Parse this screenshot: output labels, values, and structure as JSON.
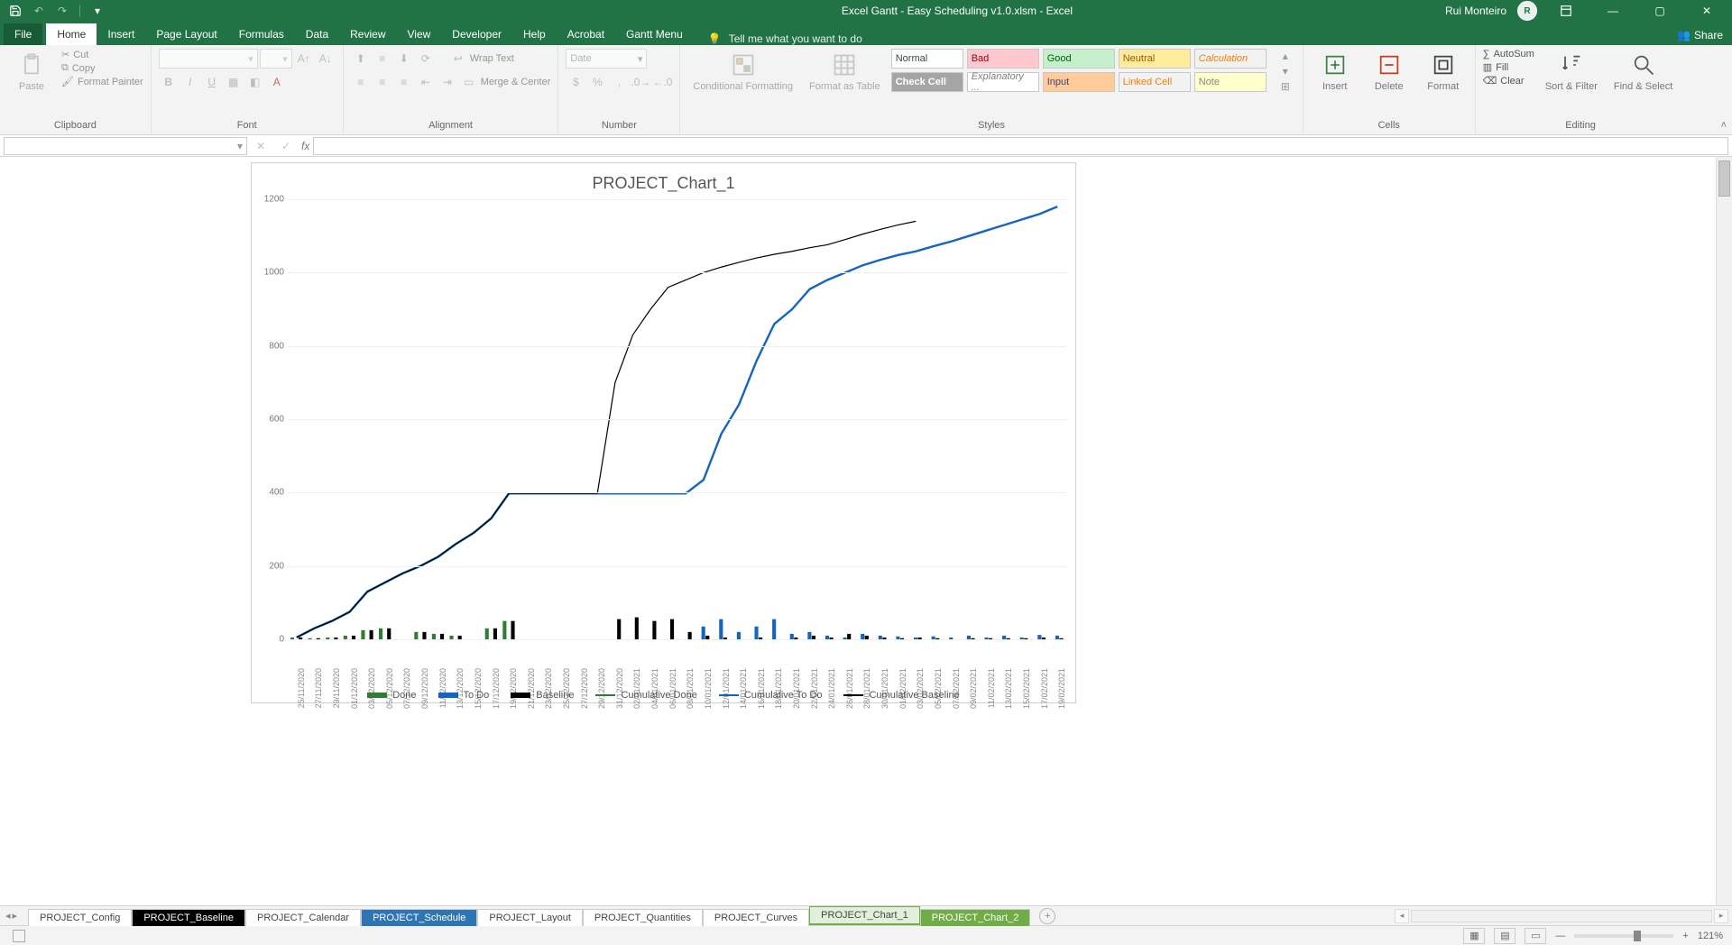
{
  "app": {
    "title": "Excel Gantt - Easy Scheduling v1.0.xlsm  -  Excel",
    "user": "Rui Monteiro"
  },
  "qat": {
    "save": "💾",
    "undo": "↶",
    "redo": "↷"
  },
  "tabs": [
    "File",
    "Home",
    "Insert",
    "Page Layout",
    "Formulas",
    "Data",
    "Review",
    "View",
    "Developer",
    "Help",
    "Acrobat",
    "Gantt Menu"
  ],
  "tell_me": "Tell me what you want to do",
  "share": "Share",
  "ribbon": {
    "clipboard": {
      "label": "Clipboard",
      "paste": "Paste",
      "cut": "Cut",
      "copy": "Copy",
      "painter": "Format Painter"
    },
    "font": {
      "label": "Font",
      "size": ""
    },
    "alignment": {
      "label": "Alignment",
      "wrap": "Wrap Text",
      "merge": "Merge & Center"
    },
    "number": {
      "label": "Number",
      "format": "Date"
    },
    "styles": {
      "label": "Styles",
      "cond": "Conditional Formatting",
      "table": "Format as Table",
      "cells": [
        "Normal",
        "Bad",
        "Good",
        "Neutral",
        "Calculation",
        "Check Cell",
        "Explanatory ...",
        "Input",
        "Linked Cell",
        "Note"
      ]
    },
    "cells": {
      "label": "Cells",
      "insert": "Insert",
      "delete": "Delete",
      "format": "Format"
    },
    "editing": {
      "label": "Editing",
      "autosum": "AutoSum",
      "fill": "Fill",
      "clear": "Clear",
      "sort": "Sort & Filter",
      "find": "Find & Select"
    }
  },
  "sheets": [
    "PROJECT_Config",
    "PROJECT_Baseline",
    "PROJECT_Calendar",
    "PROJECT_Schedule",
    "PROJECT_Layout",
    "PROJECT_Quantities",
    "PROJECT_Curves",
    "PROJECT_Chart_1",
    "PROJECT_Chart_2"
  ],
  "status": {
    "zoom": "121%"
  },
  "chart_data": {
    "type": "combo",
    "title": "PROJECT_Chart_1",
    "ylabel": "",
    "ylim": [
      0,
      1200
    ],
    "yticks": [
      0,
      200,
      400,
      600,
      800,
      1000,
      1200
    ],
    "categories": [
      "25/11/2020",
      "27/11/2020",
      "29/11/2020",
      "01/12/2020",
      "03/12/2020",
      "05/12/2020",
      "07/12/2020",
      "09/12/2020",
      "11/12/2020",
      "13/12/2020",
      "15/12/2020",
      "17/12/2020",
      "19/12/2020",
      "21/12/2020",
      "23/12/2020",
      "25/12/2020",
      "27/12/2020",
      "29/12/2020",
      "31/12/2020",
      "02/01/2021",
      "04/01/2021",
      "06/01/2021",
      "08/01/2021",
      "10/01/2021",
      "12/01/2021",
      "14/01/2021",
      "16/01/2021",
      "18/01/2021",
      "20/01/2021",
      "22/01/2021",
      "24/01/2021",
      "26/01/2021",
      "28/01/2021",
      "30/01/2021",
      "01/02/2021",
      "03/02/2021",
      "05/02/2021",
      "07/02/2021",
      "09/02/2021",
      "11/02/2021",
      "13/02/2021",
      "15/02/2021",
      "17/02/2021",
      "19/02/2021"
    ],
    "series": [
      {
        "name": "Done",
        "type": "bar",
        "color": "#2e7d32",
        "values": [
          5,
          3,
          5,
          10,
          25,
          30,
          0,
          20,
          15,
          10,
          0,
          30,
          50,
          0,
          0,
          0,
          0,
          0,
          0,
          0,
          0,
          0,
          0,
          0,
          0,
          0,
          0,
          0,
          0,
          0,
          0,
          0,
          0,
          0,
          0,
          0,
          0,
          0,
          0,
          0,
          0,
          0,
          0,
          0
        ]
      },
      {
        "name": "To Do",
        "type": "bar",
        "color": "#1565c0",
        "values": [
          0,
          0,
          0,
          0,
          0,
          0,
          0,
          0,
          0,
          0,
          0,
          0,
          0,
          0,
          0,
          0,
          0,
          0,
          0,
          0,
          0,
          0,
          0,
          35,
          55,
          20,
          35,
          55,
          15,
          20,
          10,
          5,
          15,
          10,
          8,
          5,
          8,
          5,
          10,
          5,
          10,
          5,
          12,
          10
        ]
      },
      {
        "name": "Baseline",
        "type": "bar",
        "color": "#000000",
        "values": [
          5,
          3,
          5,
          10,
          25,
          30,
          0,
          20,
          15,
          10,
          0,
          30,
          50,
          0,
          0,
          0,
          0,
          0,
          55,
          60,
          50,
          55,
          20,
          10,
          5,
          0,
          5,
          0,
          5,
          10,
          5,
          15,
          10,
          5,
          3,
          5,
          3,
          0,
          3,
          3,
          3,
          3,
          5,
          3
        ]
      },
      {
        "name": "Cumulative Done",
        "type": "line",
        "color": "#2e7d32",
        "values": [
          5,
          30,
          50,
          75,
          130,
          155,
          180,
          200,
          225,
          260,
          290,
          330,
          398,
          398,
          398,
          398,
          398,
          398,
          398,
          398,
          398,
          398,
          398,
          398,
          398,
          398,
          398,
          398,
          398,
          398,
          398,
          398,
          398,
          398,
          398,
          398,
          398,
          398,
          398,
          398,
          398,
          398,
          398,
          398
        ],
        "cutoff_index": 22
      },
      {
        "name": "Cumulative To Do",
        "type": "line",
        "color": "#1565c0",
        "values": [
          5,
          30,
          50,
          75,
          130,
          155,
          180,
          200,
          225,
          260,
          290,
          330,
          398,
          398,
          398,
          398,
          398,
          398,
          398,
          398,
          398,
          398,
          398,
          435,
          560,
          640,
          760,
          860,
          900,
          955,
          980,
          1000,
          1020,
          1035,
          1048,
          1058,
          1072,
          1085,
          1100,
          1115,
          1130,
          1145,
          1160,
          1180
        ]
      },
      {
        "name": "Cumulative Baseline",
        "type": "line",
        "color": "#000000",
        "values": [
          5,
          30,
          50,
          75,
          130,
          155,
          180,
          200,
          225,
          260,
          290,
          330,
          398,
          398,
          398,
          398,
          398,
          398,
          700,
          830,
          900,
          960,
          980,
          1000,
          1015,
          1028,
          1040,
          1050,
          1058,
          1068,
          1076,
          1090,
          1105,
          1118,
          1130,
          1140,
          1148,
          1152,
          1155,
          1157,
          1158,
          1159,
          1160,
          1160
        ],
        "cutoff_index": 35
      }
    ],
    "legend": [
      "Done",
      "To Do",
      "Baseline",
      "Cumulative Done",
      "Cumulative To Do",
      "Cumulative Baseline"
    ]
  }
}
